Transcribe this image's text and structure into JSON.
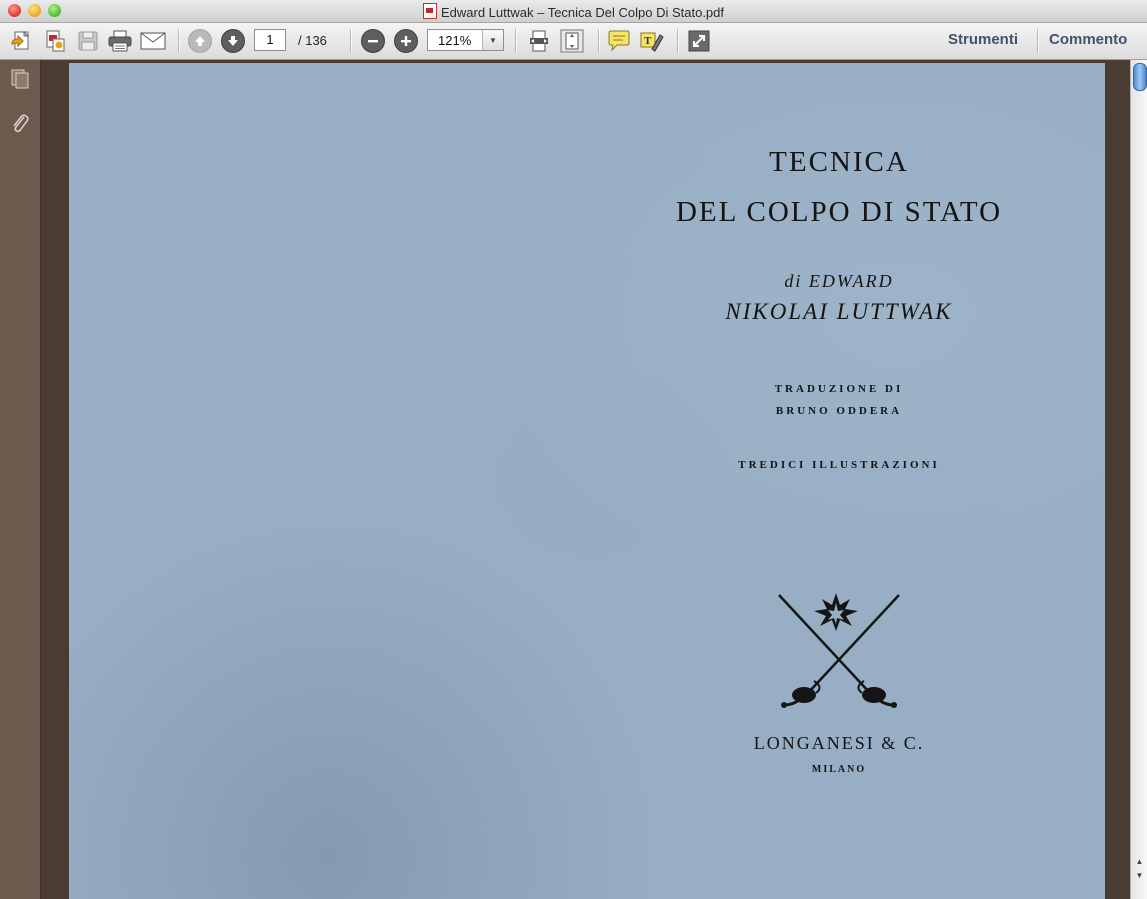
{
  "window": {
    "title": "Edward Luttwak – Tecnica Del Colpo Di Stato.pdf"
  },
  "toolbar": {
    "current_page": "1",
    "total_pages": "/ 136",
    "zoom": "121%",
    "tools_label": "Strumenti",
    "comment_label": "Commento",
    "icons": [
      "create-pdf-icon",
      "combine-files-icon",
      "save-icon",
      "print-icon",
      "email-icon",
      "page-up-icon",
      "page-down-icon",
      "zoom-out-icon",
      "zoom-in-icon",
      "fit-width-icon",
      "fit-page-icon",
      "sticky-note-icon",
      "highlight-icon",
      "fullscreen-icon"
    ]
  },
  "leftnav": {
    "icons": [
      "pages-panel-icon",
      "attachments-icon"
    ]
  },
  "document": {
    "title_line1": "TECNICA",
    "title_line2": "DEL COLPO DI STATO",
    "author_prefix": "di EDWARD",
    "author_name": "NIKOLAI LUTTWAK",
    "translation_line1": "TRADUZIONE DI",
    "translation_line2": "BRUNO ODDERA",
    "illustrations": "TREDICI ILLUSTRAZIONI",
    "publisher": "LONGANESI & C.",
    "city": "MILANO"
  },
  "colors": {
    "page_background": "#97aec4",
    "viewer_background": "#4a3c32",
    "tools_link": "#44526a"
  }
}
